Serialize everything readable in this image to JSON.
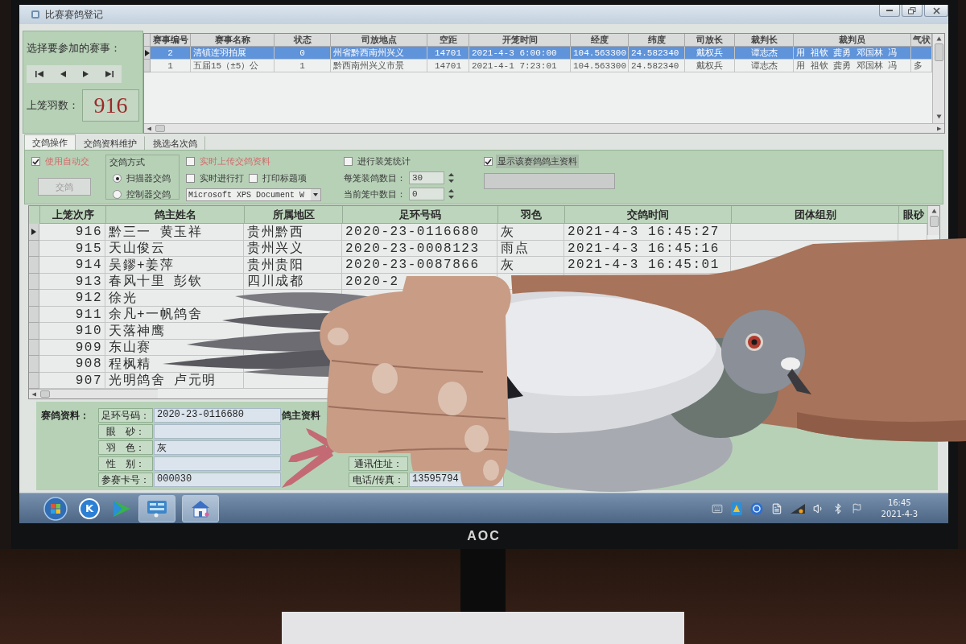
{
  "window": {
    "title": "比赛赛鸽登记"
  },
  "race_picker": {
    "prompt": "选择要参加的赛事：",
    "count_label": "上笼羽数：",
    "count": "916"
  },
  "races": {
    "columns": [
      "赛事编号",
      "赛事名称",
      "状态",
      "司放地点",
      "空距",
      "开笼时间",
      "经度",
      "纬度",
      "司放长",
      "裁判长",
      "裁判员",
      "气状"
    ],
    "rows": [
      {
        "selected": true,
        "cells": [
          "2",
          "清镇连羽拍展",
          "0",
          "州省黔西南州兴义",
          "14701",
          "2021-4-3 6:00:00",
          "104.563300",
          "24.582340",
          "戴权兵",
          "谭志杰",
          "用 祖钦 龚勇 邓国林 冯"
        ]
      },
      {
        "selected": false,
        "cells": [
          "1",
          "五届15（±5）公",
          "1",
          "黔西南州兴义市景",
          "14701",
          "2021-4-1 7:23:01",
          "104.563300",
          "24.582340",
          "戴权兵",
          "谭志杰",
          "用 祖钦 龚勇 邓国林 冯",
          "多"
        ]
      }
    ]
  },
  "tabs": [
    {
      "label": "交鸽操作",
      "selected": true
    },
    {
      "label": "交鸽资料维护",
      "selected": false
    },
    {
      "label": "挑选名次鸽",
      "selected": false
    }
  ],
  "options": {
    "auto_checkin": {
      "label": "使用自动交",
      "checked": true
    },
    "checkin_button": {
      "label": "交鸽",
      "disabled": true
    },
    "method": {
      "title": "交鸽方式",
      "choices": [
        {
          "label": "扫描器交鸽",
          "selected": true
        },
        {
          "label": "控制器交鸽",
          "selected": false
        }
      ]
    },
    "upload_live": {
      "label": "实时上传交鸽资料",
      "checked": false
    },
    "print_live": {
      "label": "实时进行打",
      "checked": false
    },
    "print_titles": {
      "label": "打印标题项",
      "checked": false
    },
    "printer": {
      "value": "Microsoft XPS Document W"
    },
    "basket_stats": {
      "label": "进行装笼统计",
      "checked": false
    },
    "per_basket": {
      "label": "每笼装鸽数目：",
      "value": "30"
    },
    "in_basket": {
      "label": "当前笼中数目：",
      "value": "0"
    },
    "show_owner": {
      "label": "显示该赛鸽鸽主资料",
      "checked": true,
      "focused": true
    }
  },
  "pigeons": {
    "columns": [
      "上笼次序",
      "鸽主姓名",
      "所属地区",
      "足环号码",
      "羽色",
      "交鸽时间",
      "团体组别",
      "眼砂"
    ],
    "rows": [
      {
        "selected": true,
        "cells": [
          "916",
          "黔三一 黄玉祥",
          "贵州黔西",
          "2020-23-0116680",
          "灰",
          "2021-4-3 16:45:27"
        ]
      },
      {
        "selected": false,
        "cells": [
          "915",
          "天山俊云",
          "贵州兴义",
          "2020-23-0008123",
          "雨点",
          "2021-4-3 16:45:16"
        ]
      },
      {
        "selected": false,
        "cells": [
          "914",
          "吴鏐+姜萍",
          "贵州贵阳",
          "2020-23-0087866",
          "灰",
          "2021-4-3 16:45:01"
        ]
      },
      {
        "selected": false,
        "cells": [
          "913",
          "春风十里 彭钦",
          "四川成都",
          "2020-2"
        ]
      },
      {
        "selected": false,
        "cells": [
          "912",
          "徐光"
        ]
      },
      {
        "selected": false,
        "cells": [
          "911",
          "余凡+一帆鸽舍"
        ]
      },
      {
        "selected": false,
        "cells": [
          "910",
          "天落神鹰"
        ]
      },
      {
        "selected": false,
        "cells": [
          "909",
          "东山赛"
        ]
      },
      {
        "selected": false,
        "cells": [
          "908",
          "程枫精"
        ]
      },
      {
        "selected": false,
        "cells": [
          "907",
          "光明鸽舍 卢元明"
        ]
      }
    ]
  },
  "pigeon_info": {
    "title": "赛鸽资料：",
    "fields": [
      {
        "label": "足环号码：",
        "value": "2020-23-0116680"
      },
      {
        "label": "眼　砂："
      },
      {
        "label": "羽　色：",
        "value": "灰"
      },
      {
        "label": "性　别："
      },
      {
        "label": "参赛卡号：",
        "value": "000030"
      }
    ]
  },
  "owner_info": {
    "title": "鸽主资料",
    "fields": [
      {
        "label": "通讯住址："
      },
      {
        "label": "电话/传真：",
        "value": "13595794"
      }
    ]
  },
  "taskbar": {
    "apps": [
      {
        "kind": "start"
      },
      {
        "kind": "letter",
        "label": "K"
      },
      {
        "kind": "player"
      },
      {
        "kind": "panel"
      },
      {
        "kind": "house"
      }
    ],
    "time": "16:45",
    "date": "2021-4-3"
  },
  "monitor": {
    "brand": "AOC"
  }
}
